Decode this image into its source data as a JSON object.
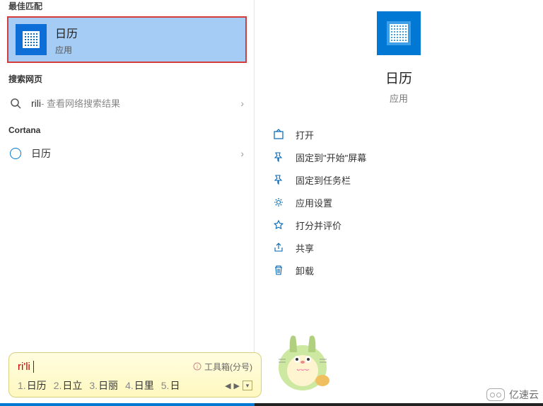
{
  "left": {
    "best_header": "最佳匹配",
    "best_app": {
      "title": "日历",
      "subtitle": "应用"
    },
    "web_header": "搜索网页",
    "web_item": {
      "query": "rili",
      "suffix": " - 查看网络搜索结果"
    },
    "cortana_header": "Cortana",
    "cortana_item": "日历"
  },
  "right": {
    "hero_title": "日历",
    "hero_sub": "应用",
    "actions": [
      {
        "icon": "open",
        "label": "打开"
      },
      {
        "icon": "pin-start",
        "label": "固定到\"开始\"屏幕"
      },
      {
        "icon": "pin-taskbar",
        "label": "固定到任务栏"
      },
      {
        "icon": "settings",
        "label": "应用设置"
      },
      {
        "icon": "rate",
        "label": "打分并评价"
      },
      {
        "icon": "share",
        "label": "共享"
      },
      {
        "icon": "uninstall",
        "label": "卸载"
      }
    ]
  },
  "ime": {
    "input": "ri'li",
    "toolbox": "工具箱(分号)",
    "candidates": [
      "日历",
      "日立",
      "日丽",
      "日里",
      "日"
    ]
  },
  "watermark": "亿速云"
}
